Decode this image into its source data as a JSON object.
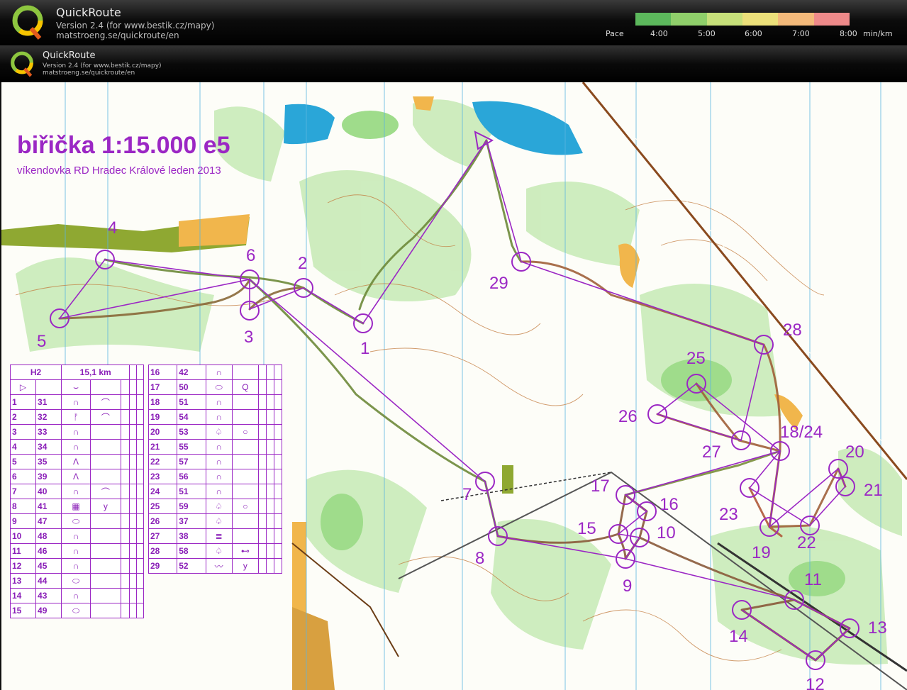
{
  "app": {
    "name": "QuickRoute",
    "version": "Version 2.4  (for www.bestik.cz/mapy)",
    "url": "matstroeng.se/quickroute/en"
  },
  "pace_legend": {
    "label": "Pace",
    "ticks": [
      "4:00",
      "5:00",
      "6:00",
      "7:00",
      "8:00"
    ],
    "unit": "min/km",
    "colors": [
      "#5cb85c",
      "#8fcf6a",
      "#c7e07a",
      "#ece07a",
      "#f3b97a",
      "#ee8a8a"
    ]
  },
  "map": {
    "title": "biřička 1:15.000 e5",
    "subtitle": "víkendovka RD Hradec Králové leden 2013",
    "controls": [
      "1",
      "2",
      "3",
      "4",
      "5",
      "6",
      "7",
      "8",
      "9",
      "10",
      "11",
      "12",
      "13",
      "14",
      "15",
      "16",
      "17",
      "18/24",
      "19",
      "20",
      "21",
      "22",
      "23",
      "25",
      "26",
      "27",
      "28",
      "29"
    ]
  },
  "description_sheet": {
    "class": "H2",
    "length": "15,1 km",
    "rows_left": [
      [
        "1",
        "31",
        "∩",
        "⌒"
      ],
      [
        "2",
        "32",
        "ᚠ",
        "⌒"
      ],
      [
        "3",
        "33",
        "∩",
        ""
      ],
      [
        "4",
        "34",
        "∩",
        ""
      ],
      [
        "5",
        "35",
        "Λ",
        ""
      ],
      [
        "6",
        "39",
        "Λ",
        ""
      ],
      [
        "7",
        "40",
        "∩",
        "⌒"
      ],
      [
        "8",
        "41",
        "▦",
        "y"
      ],
      [
        "9",
        "47",
        "⬭",
        ""
      ],
      [
        "10",
        "48",
        "∩",
        ""
      ],
      [
        "11",
        "46",
        "∩",
        ""
      ],
      [
        "12",
        "45",
        "∩",
        ""
      ],
      [
        "13",
        "44",
        "⬭",
        ""
      ],
      [
        "14",
        "43",
        "∩",
        ""
      ],
      [
        "15",
        "49",
        "⬭",
        ""
      ]
    ],
    "rows_right": [
      [
        "16",
        "42",
        "∩",
        ""
      ],
      [
        "17",
        "50",
        "⬭",
        "Q"
      ],
      [
        "18",
        "51",
        "∩",
        ""
      ],
      [
        "19",
        "54",
        "∩",
        ""
      ],
      [
        "20",
        "53",
        "♤",
        "○"
      ],
      [
        "21",
        "55",
        "∩",
        ""
      ],
      [
        "22",
        "57",
        "∩",
        ""
      ],
      [
        "23",
        "56",
        "∩",
        ""
      ],
      [
        "24",
        "51",
        "∩",
        ""
      ],
      [
        "25",
        "59",
        "♤",
        "○"
      ],
      [
        "26",
        "37",
        "♤",
        ""
      ],
      [
        "27",
        "38",
        "≣",
        ""
      ],
      [
        "28",
        "58",
        "♤",
        "⊷"
      ],
      [
        "29",
        "52",
        "〰",
        "y"
      ]
    ]
  }
}
